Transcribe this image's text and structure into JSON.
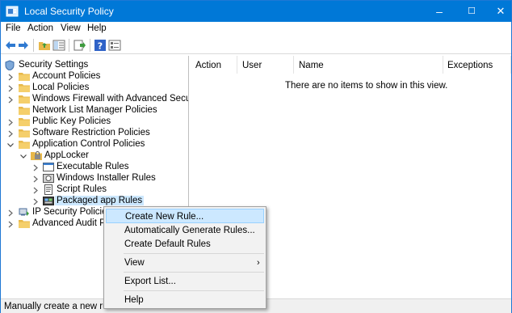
{
  "window": {
    "title": "Local Security Policy"
  },
  "menubar": [
    "File",
    "Action",
    "View",
    "Help"
  ],
  "toolbar": {
    "buttons": [
      "back-arrow-icon",
      "forward-arrow-icon",
      "up-folder-icon",
      "show-hide-tree-icon",
      "export-list-icon",
      "help-icon",
      "properties-icon"
    ]
  },
  "tree": {
    "root": "Security Settings",
    "items": [
      "Account Policies",
      "Local Policies",
      "Windows Firewall with Advanced Security",
      "Network List Manager Policies",
      "Public Key Policies",
      "Software Restriction Policies",
      "Application Control Policies",
      "AppLocker",
      "Executable Rules",
      "Windows Installer Rules",
      "Script Rules",
      "Packaged app Rules",
      "IP Security Policies o",
      "Advanced Audit Polic"
    ]
  },
  "columns": [
    "Action",
    "User",
    "Name",
    "Exceptions"
  ],
  "empty_message": "There are no items to show in this view.",
  "context_menu": {
    "items": [
      "Create New Rule...",
      "Automatically Generate Rules...",
      "Create Default Rules",
      "View",
      "Export List...",
      "Help"
    ]
  },
  "status": "Manually create a new rule",
  "colors": {
    "titlebar": "#0078d7",
    "selection": "#cce8ff",
    "folder": "#e8b84a"
  }
}
